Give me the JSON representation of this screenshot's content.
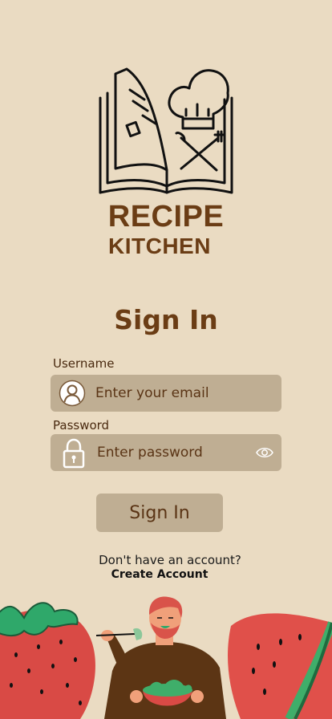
{
  "brand": {
    "line1": "RECIPE",
    "line2": "KITCHEN"
  },
  "page": {
    "title": "Sign In"
  },
  "username": {
    "label": "Username",
    "placeholder": "Enter your email",
    "value": ""
  },
  "password": {
    "label": "Password",
    "placeholder": "Enter password",
    "value": ""
  },
  "actions": {
    "sign_in": "Sign In"
  },
  "footer": {
    "prompt": "Don't have an account?",
    "create_account": "Create Account"
  },
  "colors": {
    "background": "#eadbc2",
    "field": "#bfae93",
    "brand": "#6b3d15"
  },
  "icons": {
    "logo": "recipe-book-chef-hat-icon",
    "user": "user-circle-icon",
    "lock": "lock-icon",
    "eye": "eye-icon"
  }
}
